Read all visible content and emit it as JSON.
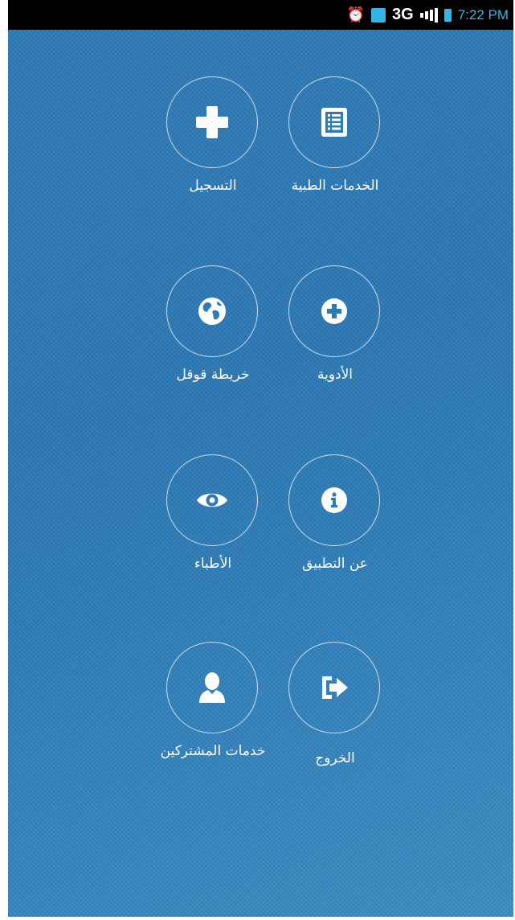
{
  "status_bar": {
    "network": "3G",
    "time": "7:22 PM",
    "icons": [
      "alarm-icon",
      "sim-icon",
      "signal-icon",
      "battery-icon"
    ]
  },
  "menu": {
    "items": [
      {
        "label": "الخدمات الطبية",
        "icon": "list-document-icon"
      },
      {
        "label": "التسجيل",
        "icon": "plus-icon"
      },
      {
        "label": "الأدوية",
        "icon": "plus-circle-icon"
      },
      {
        "label": "خريطة قوقل",
        "icon": "globe-icon"
      },
      {
        "label": "عن التطبيق",
        "icon": "info-icon"
      },
      {
        "label": "الأطباء",
        "icon": "eye-icon"
      },
      {
        "label": "الخروج",
        "icon": "sign-out-icon"
      },
      {
        "label": "خدمات المشتركين",
        "icon": "user-icon"
      }
    ]
  },
  "colors": {
    "background": "#2c7ab8",
    "status_bar": "#000000",
    "status_accent": "#33b5e5",
    "foreground": "#ffffff"
  }
}
